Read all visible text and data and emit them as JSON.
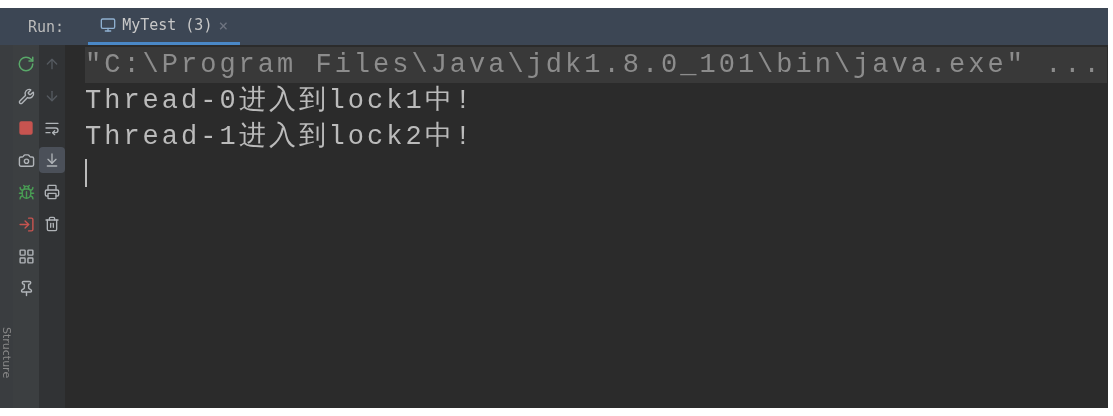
{
  "run_panel": {
    "label": "Run:",
    "tabs": [
      {
        "label": "MyTest (3)",
        "close": "×",
        "selected": true
      }
    ]
  },
  "side_stripe": {
    "label": "Structure"
  },
  "console_toolbar": [
    {
      "disabled": true,
      "selected": false
    },
    {
      "disabled": true,
      "selected": false
    },
    {
      "disabled": false,
      "selected": false
    },
    {
      "disabled": false,
      "selected": true
    },
    {
      "disabled": false,
      "selected": false
    },
    {
      "disabled": false,
      "selected": false
    }
  ],
  "console": {
    "lines": [
      {
        "kind": "command",
        "text": "\"C:\\Program Files\\Java\\jdk1.8.0_101\\bin\\java.exe\" ..."
      },
      {
        "kind": "output",
        "text": "Thread-0进入到lock1中!"
      },
      {
        "kind": "output",
        "text": "Thread-1进入到lock2中!"
      }
    ],
    "cursor": true
  }
}
